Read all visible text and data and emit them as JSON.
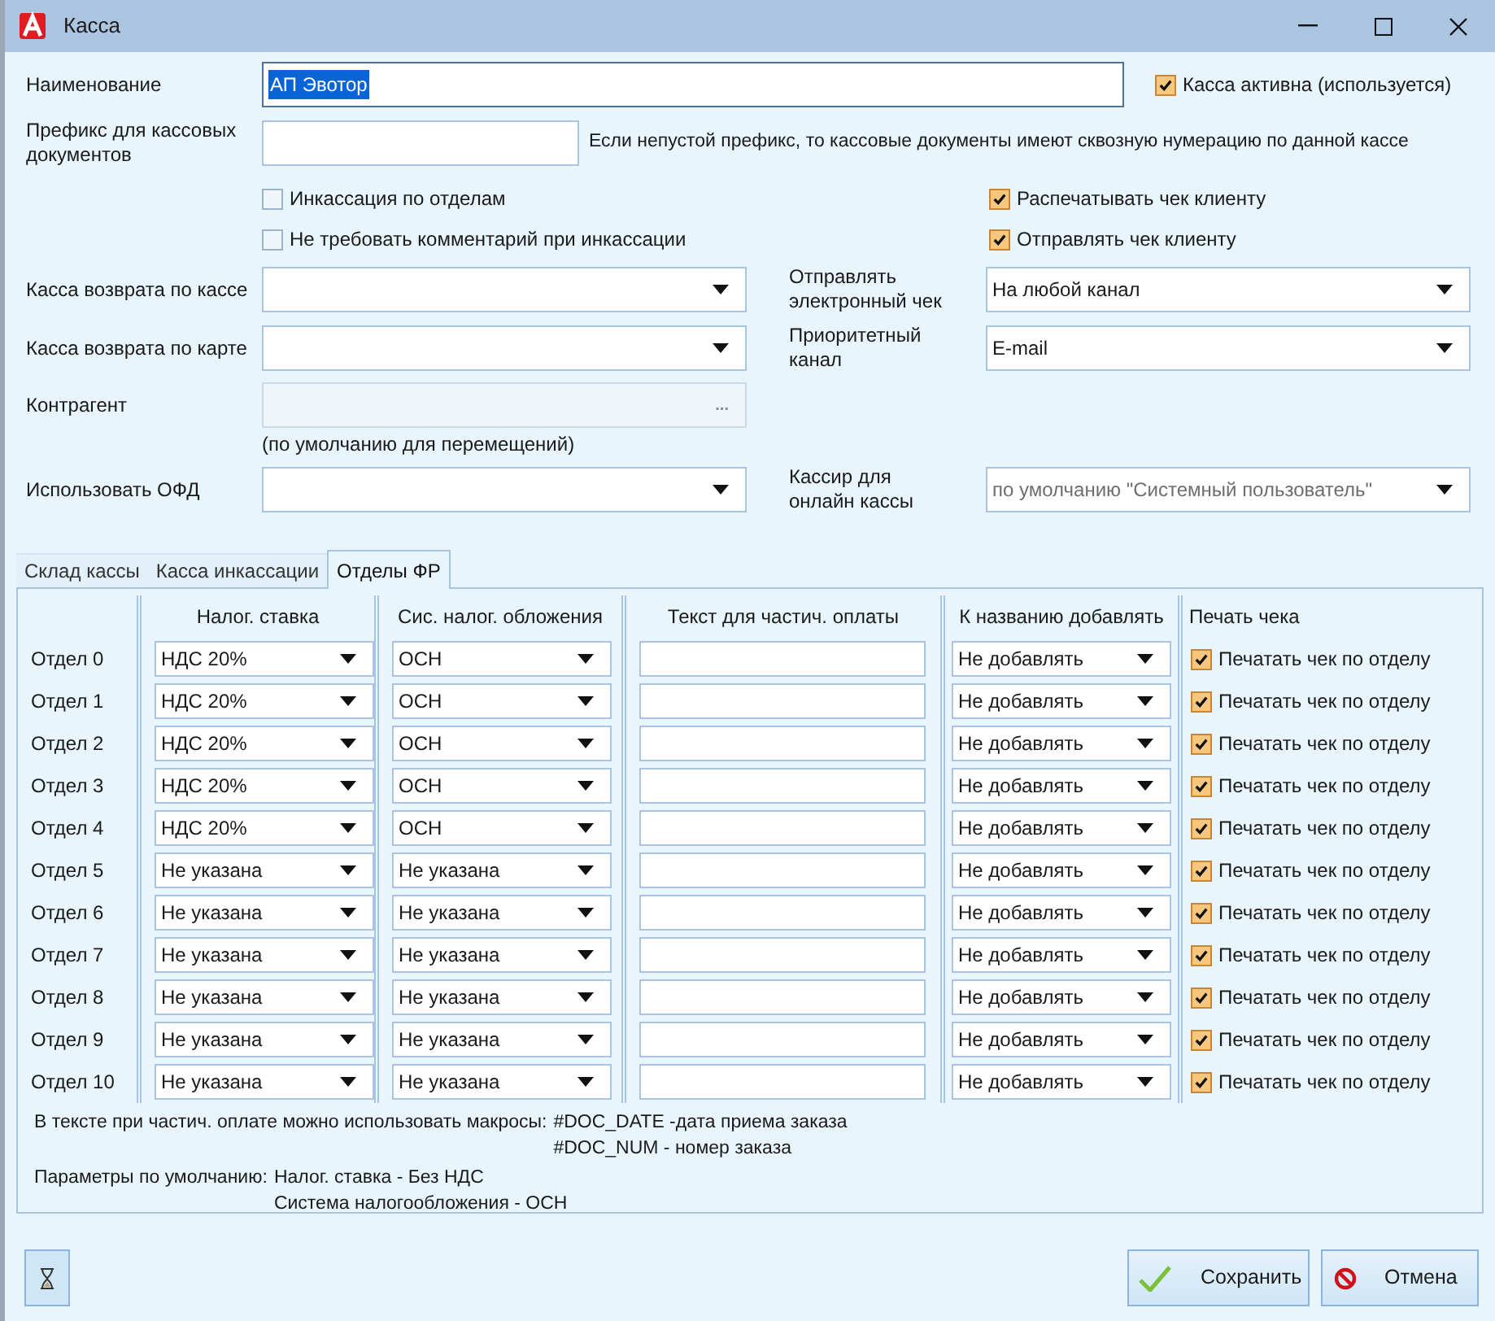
{
  "window": {
    "title": "Касса"
  },
  "name_field": {
    "label": "Наименование",
    "value": "АП Эвотор",
    "text_selected": true
  },
  "active_checkbox": {
    "label": "Касса активна (используется)",
    "checked": true
  },
  "prefix_field": {
    "label": "Префикс для кассовых документов",
    "hint": "Если непустой префикс, то кассовые документы имеют сквозную нумерацию по данной кассе"
  },
  "option_rows": [
    {
      "left": {
        "label": "Инкассация по отделам",
        "checked": false
      },
      "right": {
        "label": "Распечатывать чек клиенту",
        "checked": true
      }
    },
    {
      "left": {
        "label": "Не требовать комментарий при инкассации",
        "checked": false
      },
      "right": {
        "label": "Отправлять чек клиенту",
        "checked": true
      }
    }
  ],
  "field_rows": [
    {
      "left": {
        "label": "Касса возврата по кассе",
        "kind": "select"
      },
      "right": {
        "label": "Отправлять электронный чек",
        "kind": "select",
        "value": "На любой канал"
      }
    },
    {
      "left": {
        "label": "Касса возврата по карте",
        "kind": "select"
      },
      "right": {
        "label": "Приоритетный канал",
        "kind": "select",
        "value": "E-mail"
      }
    },
    {
      "left": {
        "label": "Контрагент",
        "kind": "picker",
        "button": "...",
        "note": "(по умолчанию для перемещений)"
      }
    },
    {
      "left": {
        "label": "Использовать ОФД",
        "kind": "select"
      },
      "right": {
        "label": "Кассир для онлайн кассы",
        "kind": "select",
        "placeholder": "по умолчанию \"Системный пользователь\""
      }
    }
  ],
  "tabs": [
    {
      "label": "Склад кассы",
      "selected": false
    },
    {
      "label": "Касса инкассации",
      "selected": false
    },
    {
      "label": "Отделы ФР",
      "selected": true
    }
  ],
  "table": {
    "columns": [
      "Налог. ставка",
      "Сис. налог. обложения",
      "Текст для частич. оплаты",
      "К названию добавлять",
      "Печать чека"
    ],
    "rows": [
      {
        "label": "Отдел 0",
        "tax_rate": "НДС 20%",
        "tax_system": "ОСН",
        "suffix": "Не добавлять",
        "print": {
          "label": "Печатать чек по отделу",
          "checked": true
        }
      },
      {
        "label": "Отдел 1",
        "tax_rate": "НДС 20%",
        "tax_system": "ОСН",
        "suffix": "Не добавлять",
        "print": {
          "label": "Печатать чек по отделу",
          "checked": true
        }
      },
      {
        "label": "Отдел 2",
        "tax_rate": "НДС 20%",
        "tax_system": "ОСН",
        "suffix": "Не добавлять",
        "print": {
          "label": "Печатать чек по отделу",
          "checked": true
        }
      },
      {
        "label": "Отдел 3",
        "tax_rate": "НДС 20%",
        "tax_system": "ОСН",
        "suffix": "Не добавлять",
        "print": {
          "label": "Печатать чек по отделу",
          "checked": true
        }
      },
      {
        "label": "Отдел 4",
        "tax_rate": "НДС 20%",
        "tax_system": "ОСН",
        "suffix": "Не добавлять",
        "print": {
          "label": "Печатать чек по отделу",
          "checked": true
        }
      },
      {
        "label": "Отдел 5",
        "tax_rate": "Не указана",
        "tax_system": "Не указана",
        "suffix": "Не добавлять",
        "print": {
          "label": "Печатать чек по отделу",
          "checked": true
        }
      },
      {
        "label": "Отдел 6",
        "tax_rate": "Не указана",
        "tax_system": "Не указана",
        "suffix": "Не добавлять",
        "print": {
          "label": "Печатать чек по отделу",
          "checked": true
        }
      },
      {
        "label": "Отдел 7",
        "tax_rate": "Не указана",
        "tax_system": "Не указана",
        "suffix": "Не добавлять",
        "print": {
          "label": "Печатать чек по отделу",
          "checked": true
        }
      },
      {
        "label": "Отдел 8",
        "tax_rate": "Не указана",
        "tax_system": "Не указана",
        "suffix": "Не добавлять",
        "print": {
          "label": "Печатать чек по отделу",
          "checked": true
        }
      },
      {
        "label": "Отдел 9",
        "tax_rate": "Не указана",
        "tax_system": "Не указана",
        "suffix": "Не добавлять",
        "print": {
          "label": "Печатать чек по отделу",
          "checked": true
        }
      },
      {
        "label": "Отдел 10",
        "tax_rate": "Не указана",
        "tax_system": "Не указана",
        "suffix": "Не добавлять",
        "print": {
          "label": "Печатать чек по отделу",
          "checked": true
        }
      }
    ]
  },
  "notes": [
    {
      "label": "В тексте при частич. оплате можно использовать макросы:",
      "lines": [
        "#DOC_DATE -дата приема заказа",
        "#DOC_NUM - номер заказа"
      ]
    },
    {
      "label": "Параметры по умолчанию:",
      "lines": [
        "Налог. ставка - Без НДС",
        "Система налогообложения - ОСН"
      ]
    }
  ],
  "buttons": [
    {
      "label": "Сохранить",
      "kind": "save"
    },
    {
      "label": "Отмена",
      "kind": "cancel"
    }
  ]
}
